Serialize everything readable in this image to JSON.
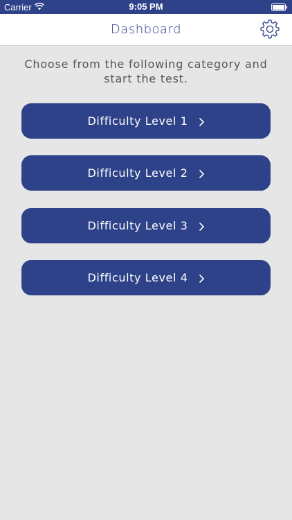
{
  "status_bar": {
    "carrier": "Carrier",
    "time": "9:05 PM"
  },
  "navbar": {
    "title": "Dashboard",
    "settings_icon": "gear-icon"
  },
  "intro_text": "Choose from the following category and start the test.",
  "levels": [
    {
      "label": "Difficulty Level 1"
    },
    {
      "label": "Difficulty Level 2"
    },
    {
      "label": "Difficulty Level 3"
    },
    {
      "label": "Difficulty Level 4"
    }
  ],
  "colors": {
    "primary": "#2d4288",
    "background": "#e6e6e6",
    "navbar_bg": "#ffffff",
    "text_muted": "#555555"
  }
}
